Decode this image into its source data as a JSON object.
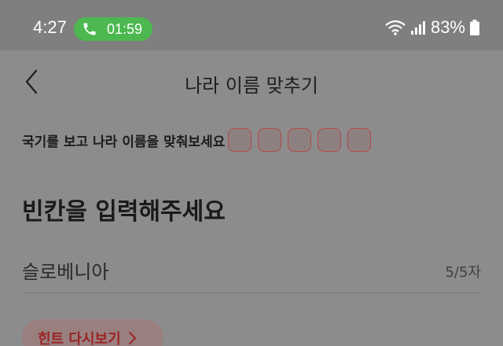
{
  "status_bar": {
    "time": "4:27",
    "call_timer": "01:59",
    "battery": "83%",
    "call_pill_color": "#4cb84f"
  },
  "header": {
    "title": "나라 이름 맞추기",
    "back_icon": "chevron-left-icon"
  },
  "quiz": {
    "instruction": "국기를 보고 나라 이름을 맞춰보세요",
    "progress_slots": 5,
    "heading": "빈칸을 입력해주세요",
    "answer_value": "슬로베니아",
    "char_count": "5/5자",
    "accent_color": "#b24a4a"
  },
  "hint": {
    "label": "힌트 다시보기",
    "icon": "chevron-right-icon"
  }
}
